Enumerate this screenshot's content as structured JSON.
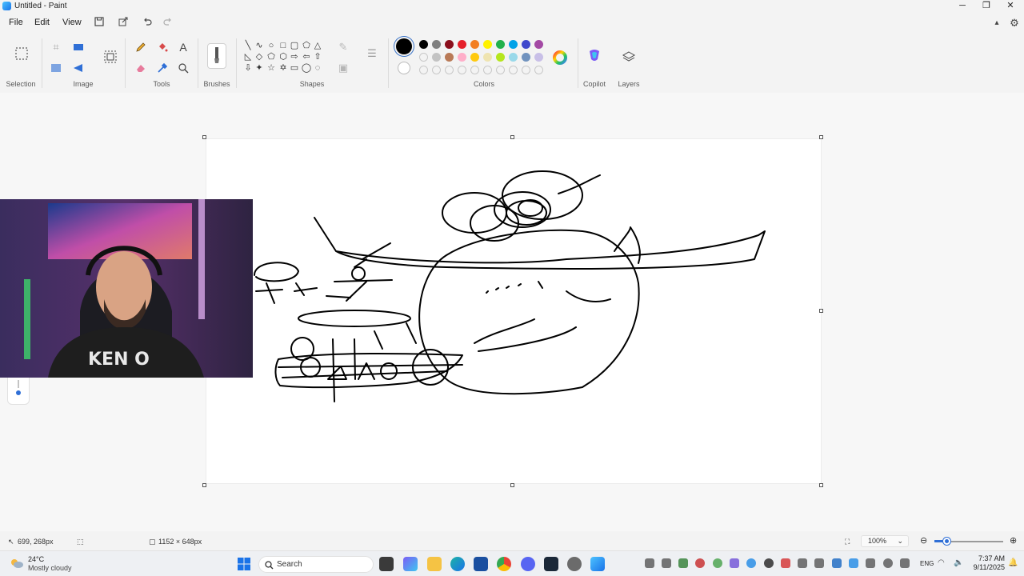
{
  "window": {
    "title": "Untitled - Paint",
    "minimize": "─",
    "maximize": "❐",
    "close": "✕"
  },
  "menu": {
    "file": "File",
    "edit": "Edit",
    "view": "View"
  },
  "ribbon": {
    "groups": {
      "selection": "Selection",
      "image": "Image",
      "tools": "Tools",
      "brushes": "Brushes",
      "shapes": "Shapes",
      "colors": "Colors",
      "copilot": "Copilot",
      "layers": "Layers"
    },
    "primary_color": "#000000",
    "secondary_color": "#ffffff",
    "palette_row1": [
      "#000000",
      "#7f7f7f",
      "#8b0f1c",
      "#e5202a",
      "#f27e22",
      "#fff200",
      "#22b14c",
      "#00a2e8",
      "#3f48cc",
      "#a349a4"
    ],
    "palette_row2": [
      "empty",
      "#c3c3c3",
      "#b97a57",
      "#ffaec9",
      "#ffc90e",
      "#efe4b0",
      "#b5e61d",
      "#99d9ea",
      "#7092be",
      "#c8bfe7"
    ]
  },
  "canvas": {
    "background": "#ffffff",
    "stroke": "#000000"
  },
  "status": {
    "cursor_position": "699, 268px",
    "canvas_size": "1152 × 648px",
    "zoom": "100%",
    "zoom_level": 0.19
  },
  "taskbar": {
    "weather_temp": "24°C",
    "weather_desc": "Mostly cloudy",
    "search_label": "Search",
    "language": "ENG",
    "time": "7:37 AM",
    "date": "9/11/2025"
  }
}
